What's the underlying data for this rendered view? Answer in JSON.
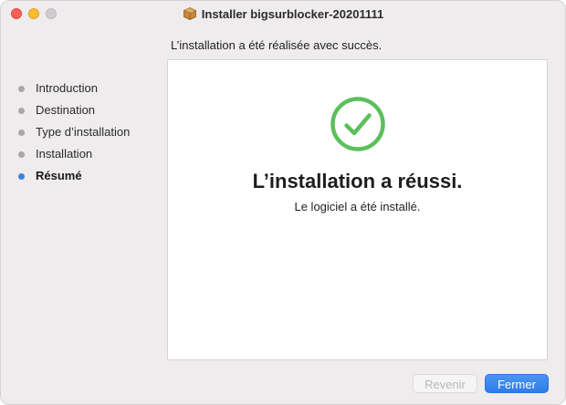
{
  "window": {
    "title": "Installer bigsurblocker-20201111",
    "heading": "L’installation a été réalisée avec succès."
  },
  "sidebar": {
    "items": [
      {
        "label": "Introduction",
        "active": false
      },
      {
        "label": "Destination",
        "active": false
      },
      {
        "label": "Type d’installation",
        "active": false
      },
      {
        "label": "Installation",
        "active": false
      },
      {
        "label": "Résumé",
        "active": true
      }
    ]
  },
  "main": {
    "title": "L’installation a réussi.",
    "subtitle": "Le logiciel a été installé.",
    "icon": "checkmark-circle-icon"
  },
  "buttons": {
    "back_label": "Revenir",
    "close_label": "Fermer"
  },
  "colors": {
    "accent": "#3b82e4",
    "success": "#5cbf5c",
    "inactive_dot": "#a8a6a8"
  }
}
